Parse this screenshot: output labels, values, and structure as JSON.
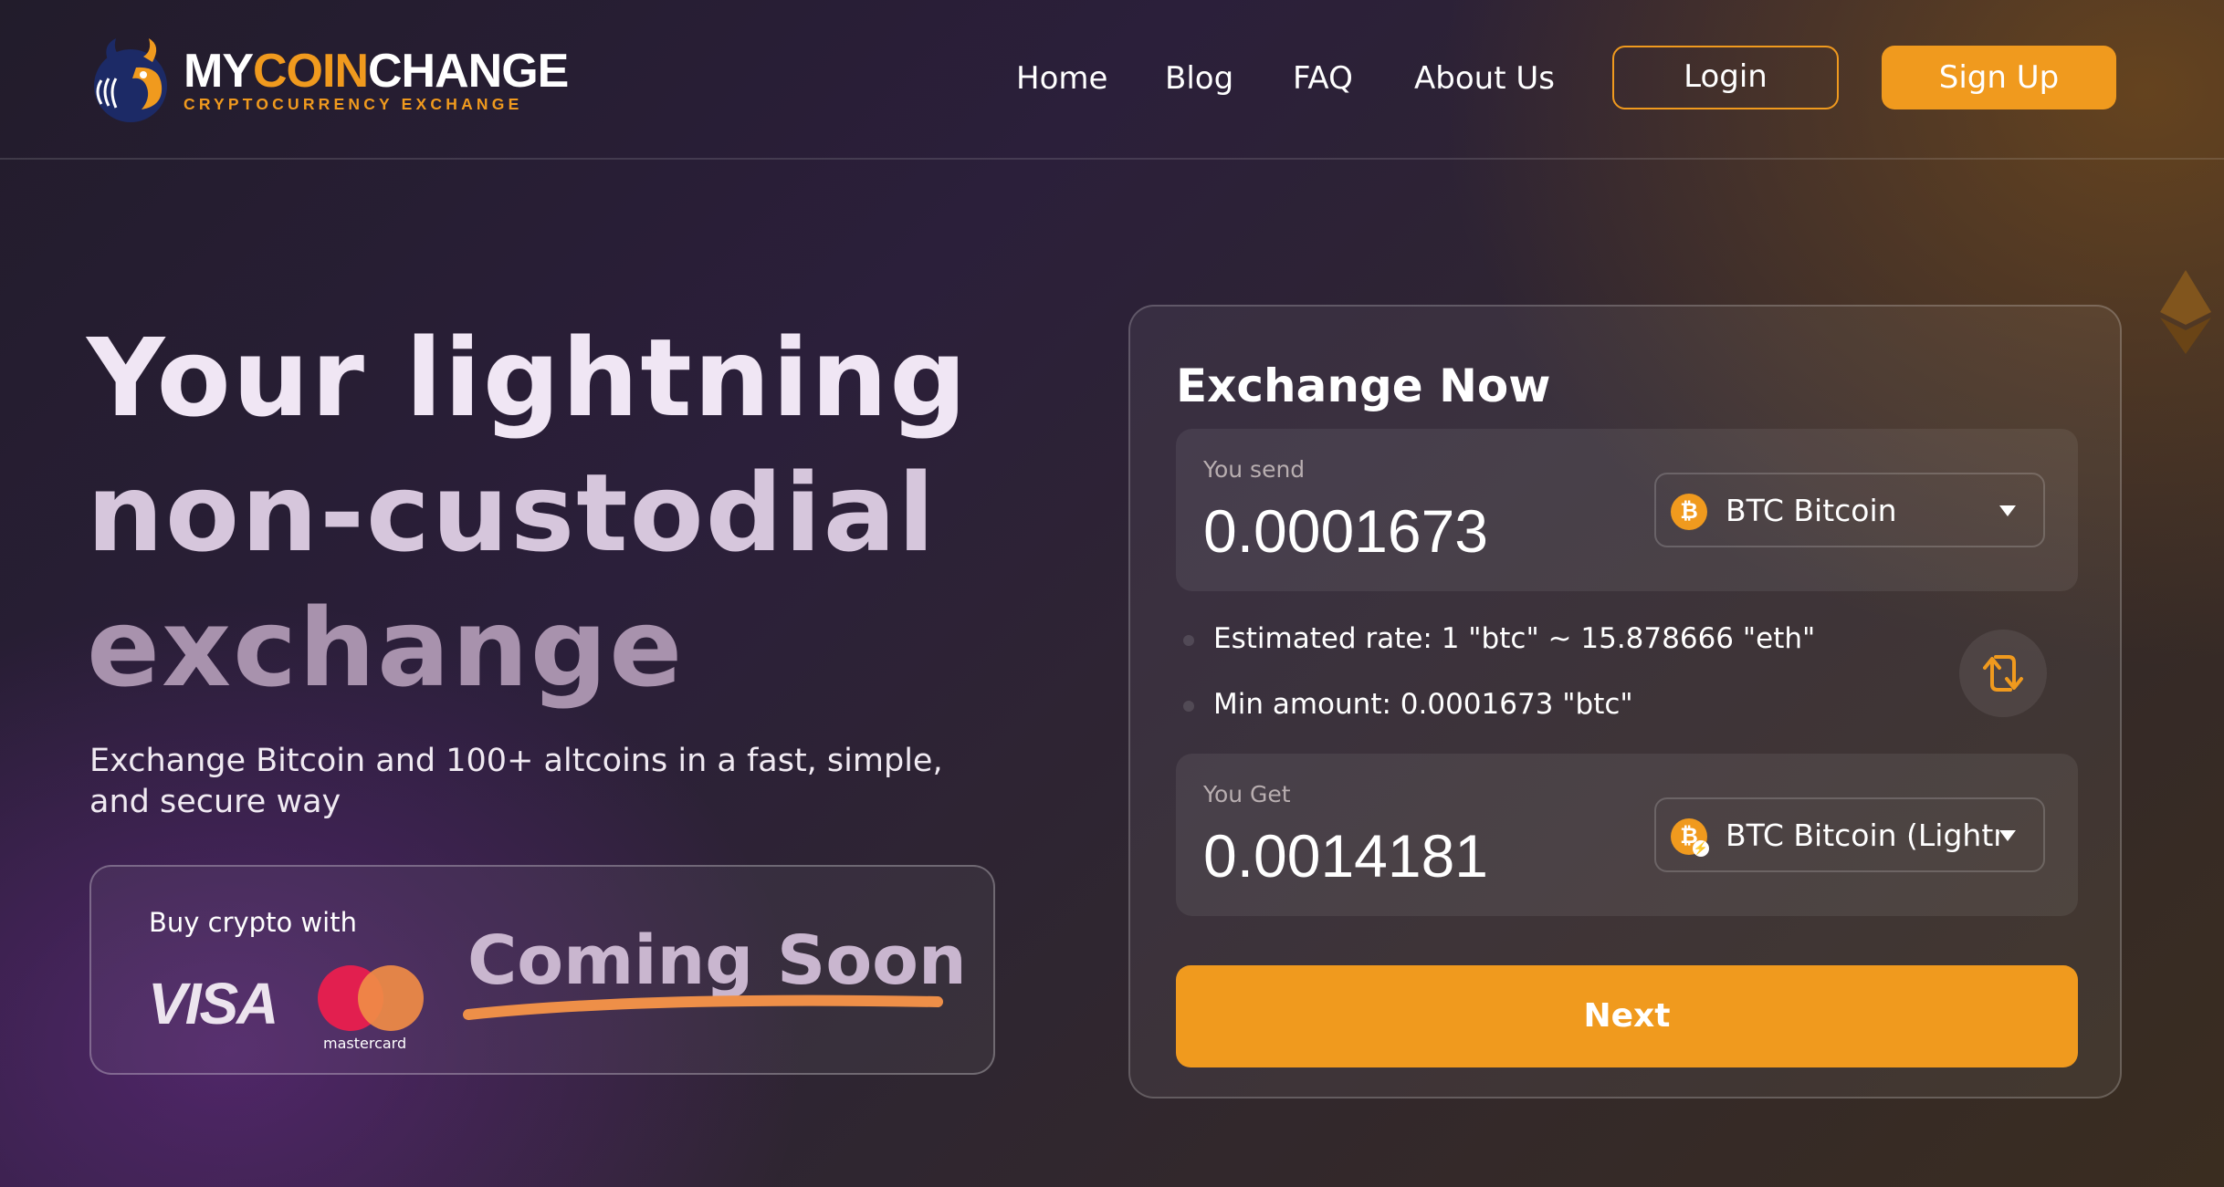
{
  "brand": {
    "name_part1": "MY",
    "name_part2": "COIN",
    "name_part3": "CHANGE",
    "tagline": "CRYPTOCURRENCY EXCHANGE",
    "accent_color": "#f09a1e",
    "logo_icon": "bull-head-icon"
  },
  "nav": {
    "items": [
      {
        "label": "Home"
      },
      {
        "label": "Blog"
      },
      {
        "label": "FAQ"
      },
      {
        "label": "About Us"
      }
    ],
    "login_label": "Login",
    "signup_label": "Sign Up"
  },
  "hero": {
    "title_line1": "Your lightning",
    "title_line2": "non-custodial",
    "title_line3": "exchange",
    "subtitle": "Exchange Bitcoin and 100+ altcoins in a fast, simple, and secure way"
  },
  "buy_crypto": {
    "label": "Buy crypto with",
    "visa_label": "VISA",
    "mastercard_label": "mastercard",
    "coming_soon": "Coming Soon"
  },
  "exchange": {
    "title": "Exchange Now",
    "send": {
      "label": "You send",
      "amount": "0.0001673",
      "coin": "BTC Bitcoin",
      "coin_icon": "bitcoin-icon"
    },
    "rate_text": "Estimated rate: 1 \"btc\" ~ 15.878666 \"eth\"",
    "min_text": "Min amount: 0.0001673 \"btc\"",
    "swap_icon": "swap-arrows-icon",
    "get": {
      "label": "You Get",
      "amount": "0.0014181",
      "coin": "BTC Bitcoin (Lightning)",
      "coin_icon": "bitcoin-lightning-icon"
    },
    "next_label": "Next"
  }
}
